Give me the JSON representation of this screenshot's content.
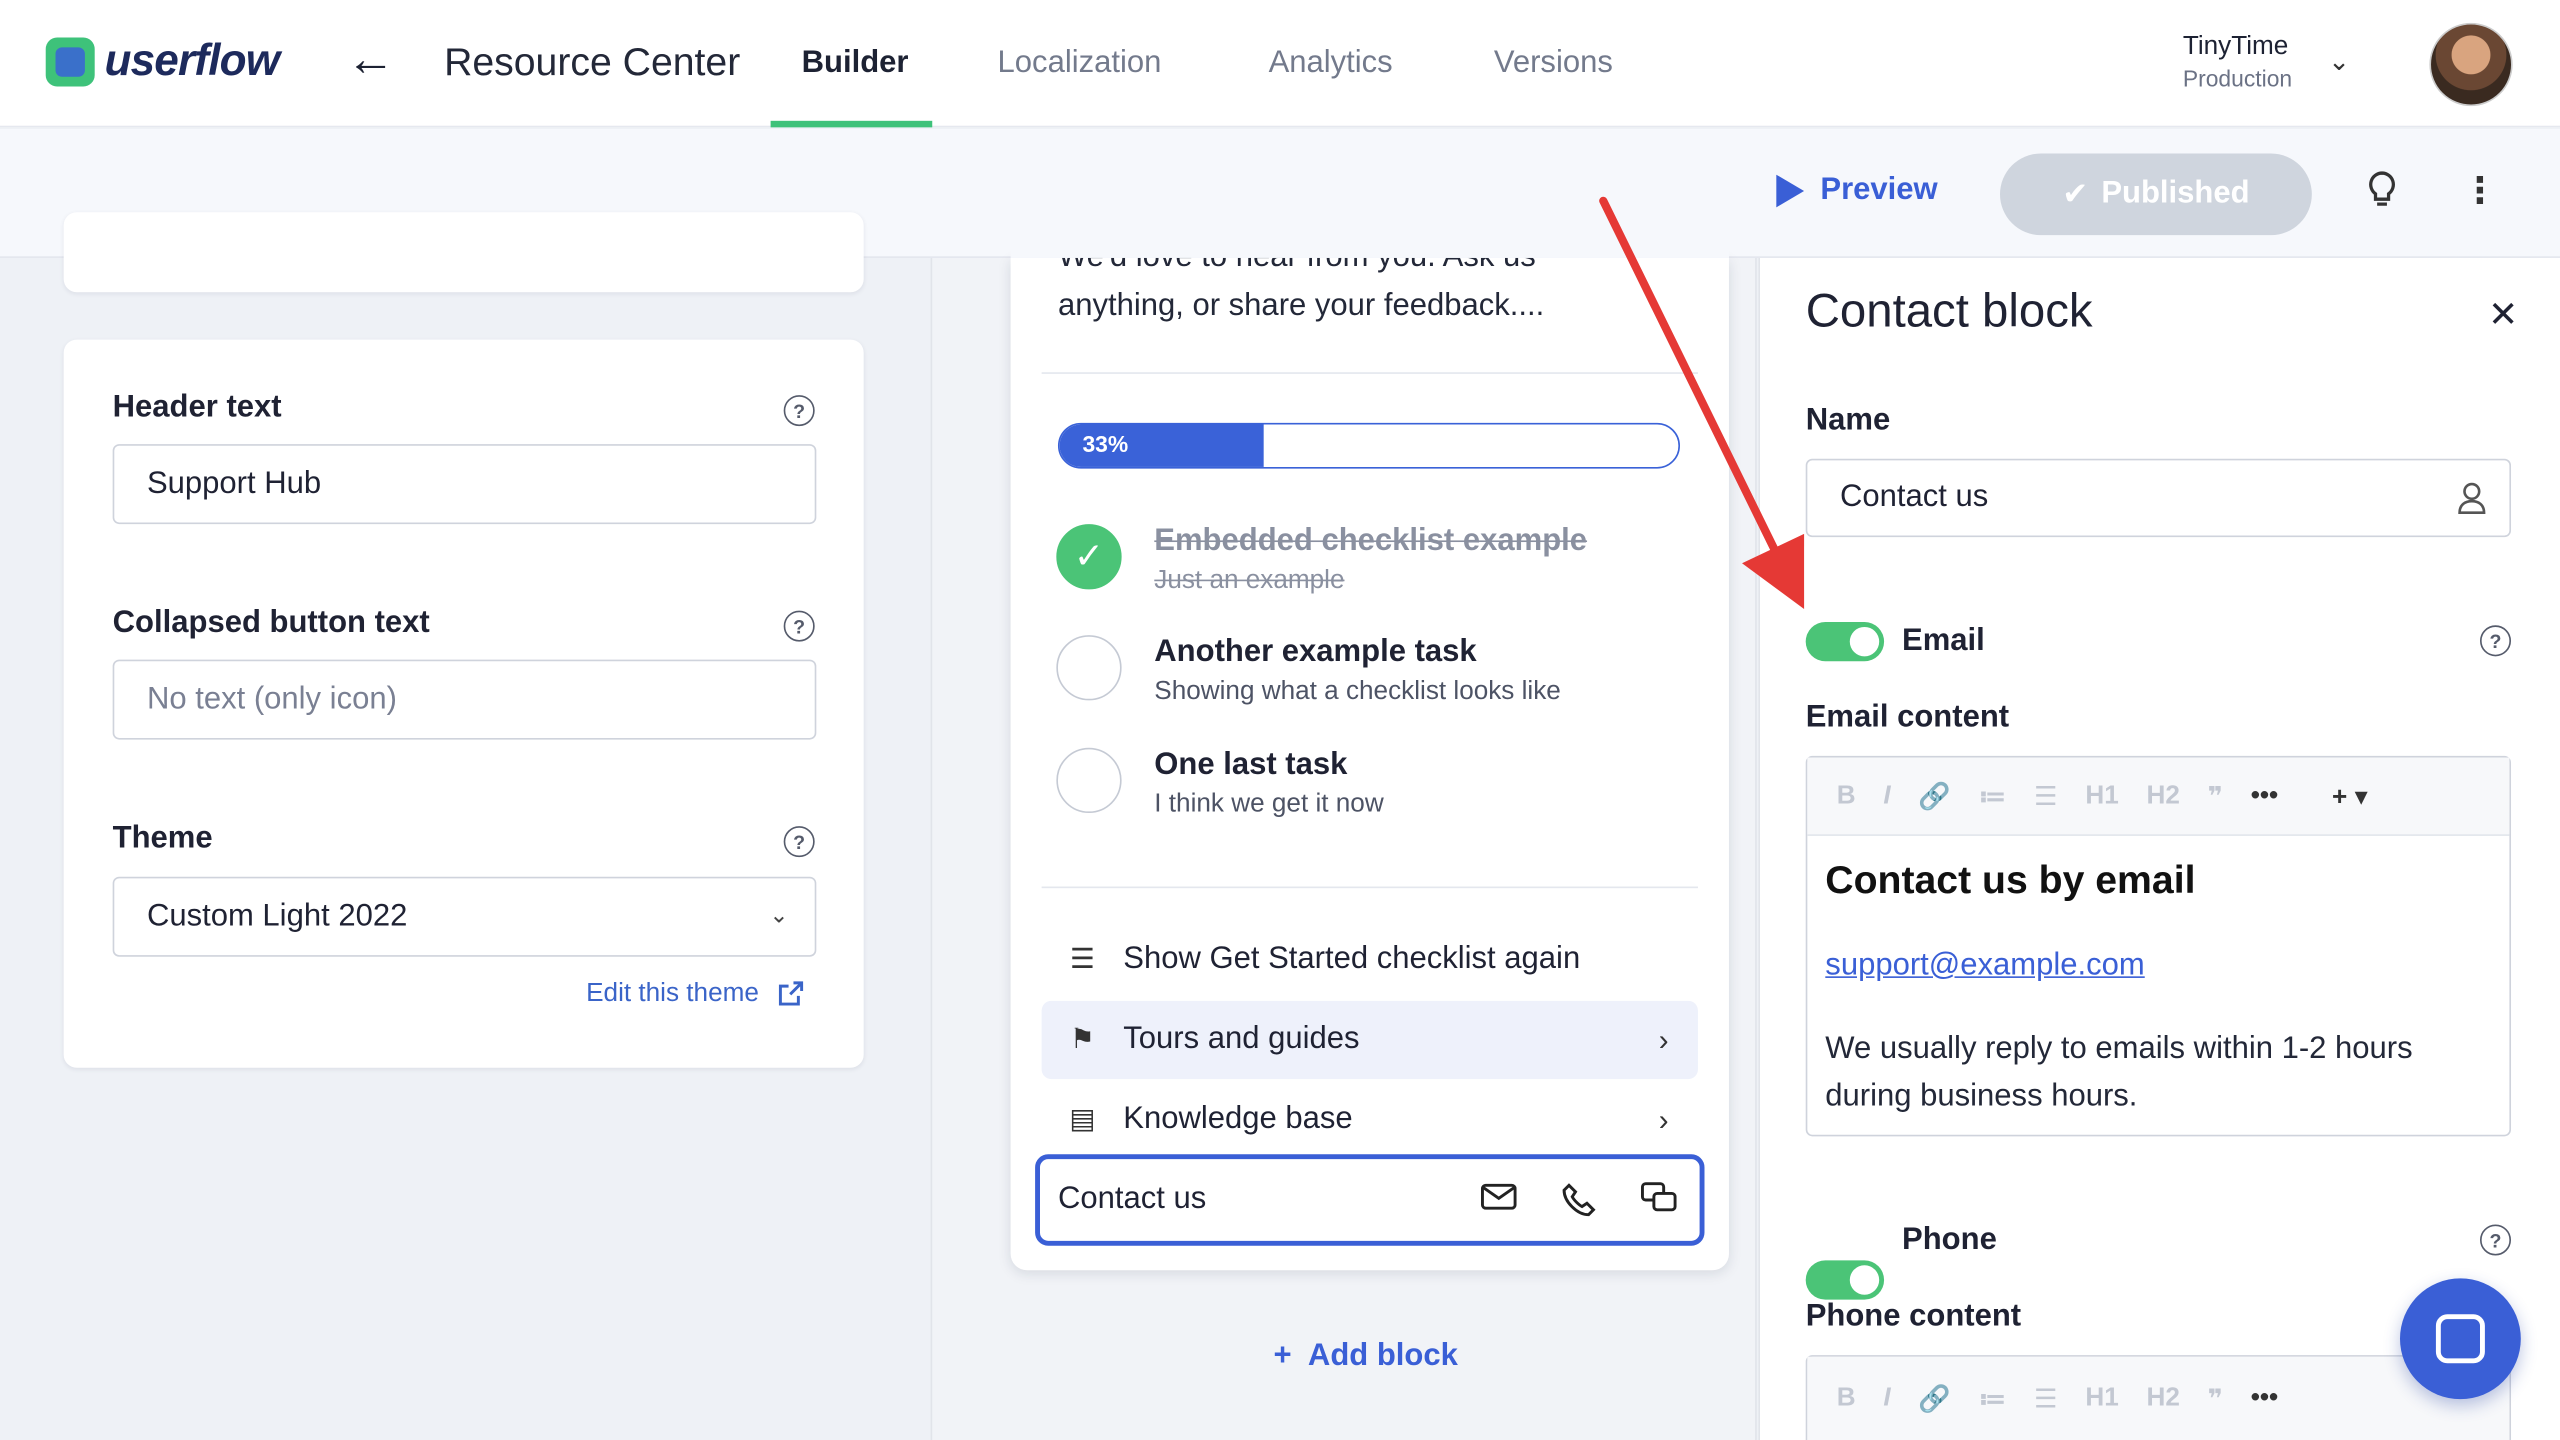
{
  "brand": {
    "name": "userflow"
  },
  "nav": {
    "title": "Resource Center",
    "tabs": [
      {
        "label": "Builder",
        "active": true
      },
      {
        "label": "Localization"
      },
      {
        "label": "Analytics"
      },
      {
        "label": "Versions"
      }
    ],
    "org": {
      "name": "TinyTime",
      "environment": "Production"
    }
  },
  "toolbar": {
    "preview_label": "Preview",
    "published_label": "Published"
  },
  "left_panel": {
    "header_text": {
      "label": "Header text",
      "value": "Support Hub"
    },
    "collapsed_button_text": {
      "label": "Collapsed button text",
      "placeholder": "No text (only icon)"
    },
    "theme": {
      "label": "Theme",
      "value": "Custom Light 2022",
      "edit_link": "Edit this theme"
    }
  },
  "preview": {
    "intro_partial": "We'd love to hear from you. Ask us",
    "intro_line2": "anything, or share your feedback....",
    "progress": {
      "label": "33%",
      "value": 0.33
    },
    "tasks": [
      {
        "title": "Embedded checklist example",
        "subtitle": "Just an example",
        "done": true
      },
      {
        "title": "Another example task",
        "subtitle": "Showing what a checklist looks like",
        "done": false
      },
      {
        "title": "One last task",
        "subtitle": "I think we get it now",
        "done": false
      }
    ],
    "menu": [
      {
        "label": "Show Get Started checklist again",
        "icon": "checklist-icon"
      },
      {
        "label": "Tours and guides",
        "icon": "signpost-icon"
      },
      {
        "label": "Knowledge base",
        "icon": "document-icon"
      }
    ],
    "contact": {
      "label": "Contact us",
      "icons": [
        "mail-icon",
        "phone-icon",
        "chat-icon"
      ]
    },
    "add_block_label": "Add block"
  },
  "right_panel": {
    "title": "Contact block",
    "name_label": "Name",
    "name_value": "Contact us",
    "email": {
      "toggle_label": "Email",
      "enabled": true,
      "content_label": "Email content",
      "heading": "Contact us by email",
      "link": "support@example.com",
      "body": "We usually reply to emails within 1-2 hours during business hours."
    },
    "phone": {
      "toggle_label": "Phone",
      "enabled": true,
      "content_label": "Phone content"
    },
    "editor_buttons": [
      "B",
      "I",
      "🔗",
      "≔",
      "☰",
      "H1",
      "H2",
      "❞",
      "•••",
      "+ ▾"
    ]
  },
  "colors": {
    "accent": "#3a5fd6",
    "green": "#4bc477",
    "annotation": "#e53935"
  }
}
